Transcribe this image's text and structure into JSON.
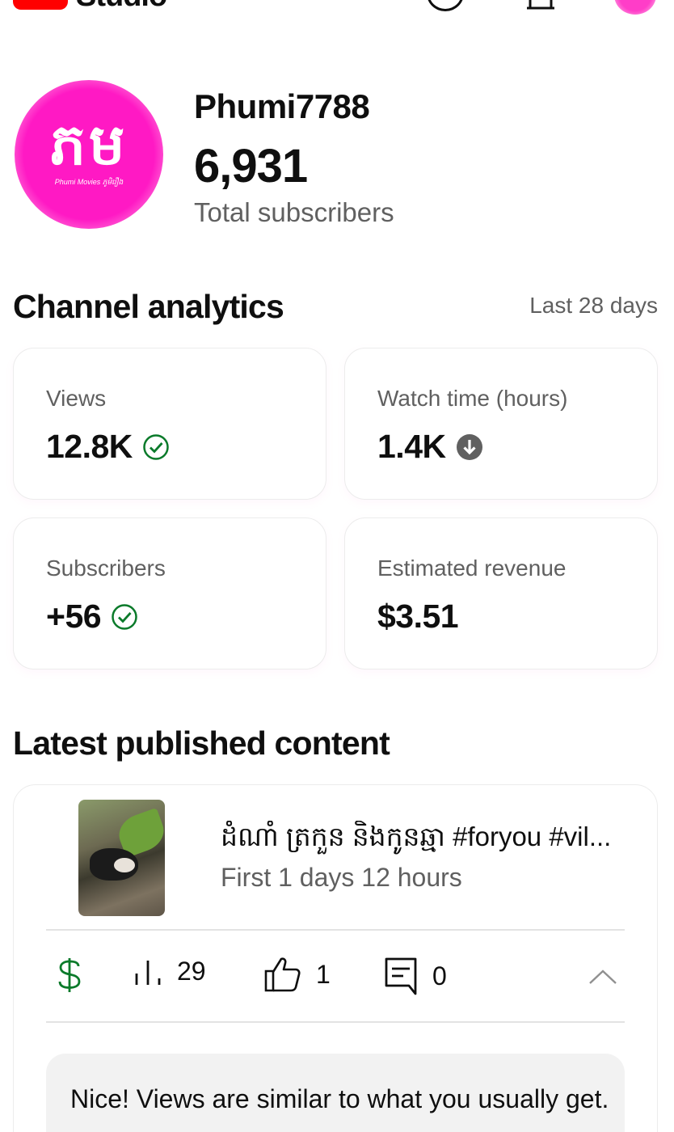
{
  "app": {
    "logo_text": "Studio",
    "brand_color": "#ff0000"
  },
  "channel": {
    "avatar_glyph": "ភម",
    "avatar_subtext": "Phumi Movies ភូមិរឿង",
    "name": "Phumi7788",
    "subscribers": "6,931",
    "subscribers_label": "Total subscribers"
  },
  "analytics": {
    "title": "Channel analytics",
    "range": "Last 28 days",
    "cards": [
      {
        "label": "Views",
        "value": "12.8K",
        "status_icon": "check-circle-icon",
        "status_color": "#0a7a2a"
      },
      {
        "label": "Watch time (hours)",
        "value": "1.4K",
        "status_icon": "down-arrow-circle-icon",
        "status_color": "#606060"
      },
      {
        "label": "Subscribers",
        "value": "+56",
        "status_icon": "check-circle-icon",
        "status_color": "#0a7a2a"
      },
      {
        "label": "Estimated revenue",
        "value": "$3.51",
        "status_icon": "",
        "status_color": ""
      }
    ]
  },
  "latest": {
    "title": "Latest published content",
    "video": {
      "title": "ដំណាំ ត្រកួន និងកូនឆ្មា #foryou #vil...",
      "meta": "First 1 days 12 hours"
    },
    "stats": {
      "views": "29",
      "likes": "1",
      "comments": "0"
    },
    "insight": "Nice! Views are similar to what you usually get."
  }
}
